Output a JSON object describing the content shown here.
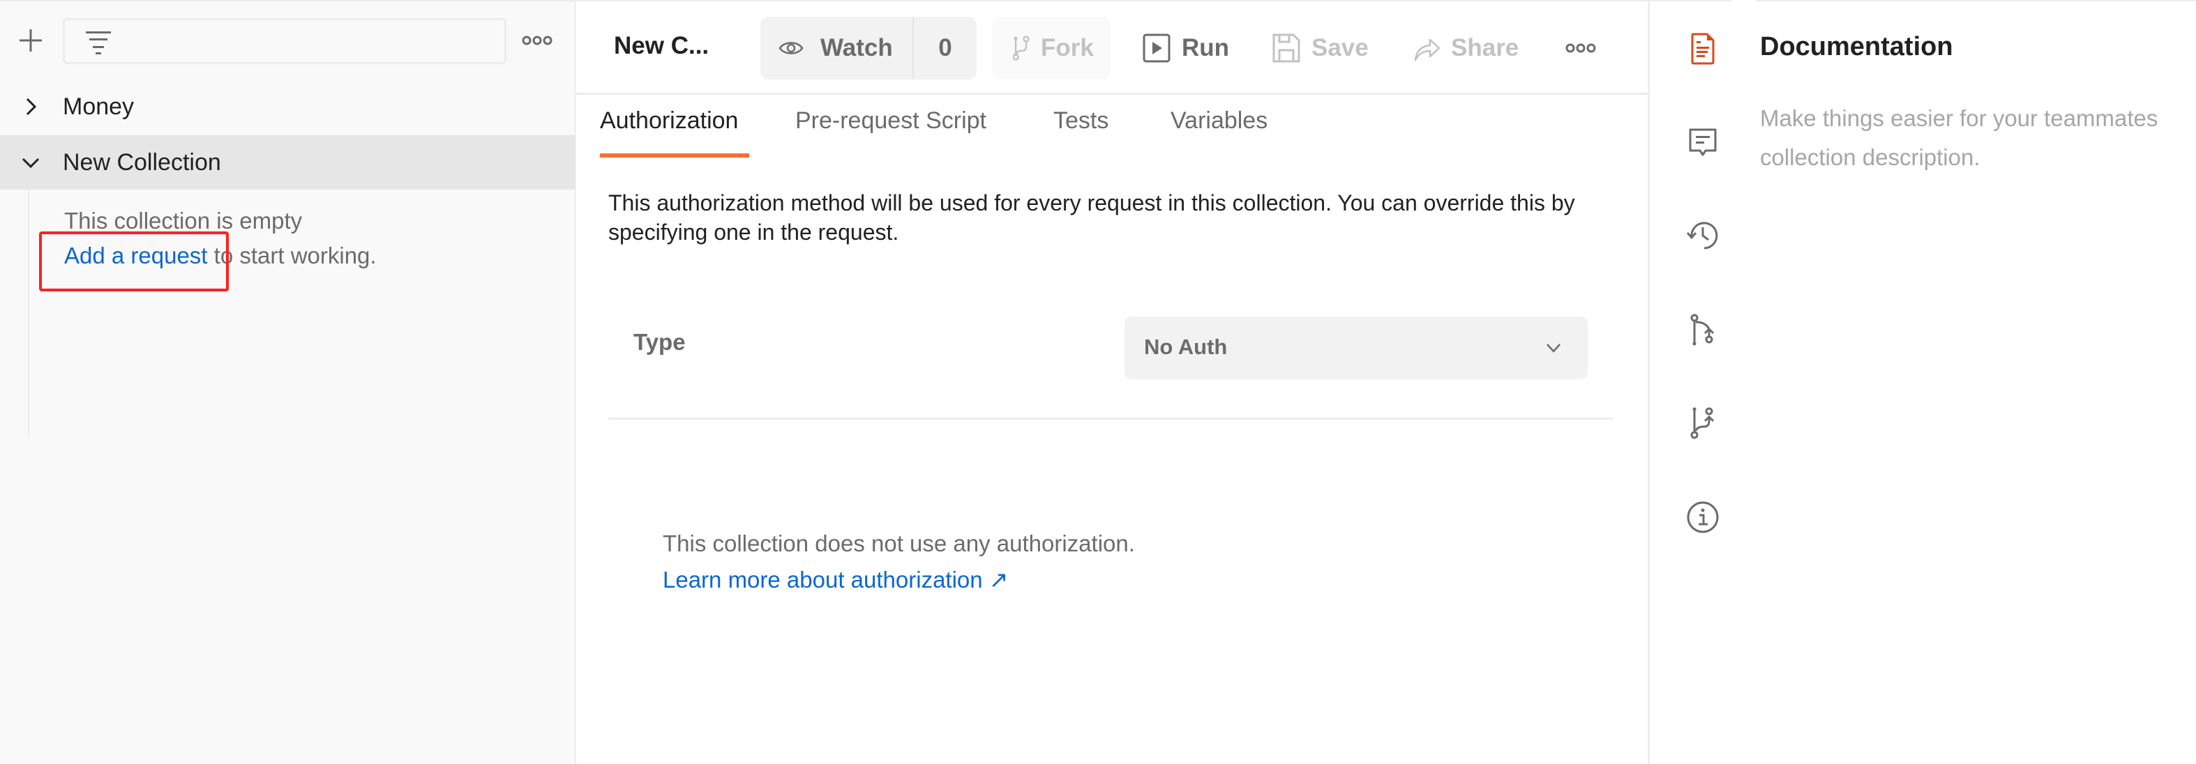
{
  "sidebar": {
    "new_button_icon": "plus-icon",
    "filter_icon": "filter-icon",
    "search_placeholder": "",
    "more_icon": "more-horizontal-icon",
    "collections": [
      {
        "name": "Money",
        "expanded": false
      },
      {
        "name": "New Collection",
        "expanded": true,
        "selected": true
      }
    ],
    "empty_state": {
      "line1": "This collection is empty",
      "link": "Add a request",
      "line2_suffix": " to start working."
    }
  },
  "header": {
    "title": "New C...",
    "watch_label": "Watch",
    "watch_count": "0",
    "fork_label": "Fork",
    "run_label": "Run",
    "save_label": "Save",
    "share_label": "Share"
  },
  "tabs": [
    {
      "label": "Authorization",
      "active": true
    },
    {
      "label": "Pre-request Script",
      "active": false
    },
    {
      "label": "Tests",
      "active": false
    },
    {
      "label": "Variables",
      "active": false
    }
  ],
  "authorization": {
    "description": "This authorization method will be used for every request in this collection. You can override this by specifying one in the request.",
    "type_label": "Type",
    "type_value": "No Auth",
    "no_auth_text": "This collection does not use any authorization.",
    "learn_more_link": "Learn more about authorization ↗"
  },
  "right_panel": {
    "title": "Documentation",
    "description_line1": "Make things easier for your teammates",
    "description_line2": "collection description.",
    "icons": [
      "documentation-icon",
      "comments-icon",
      "history-icon",
      "pull-request-icon",
      "fork-info-icon",
      "info-icon"
    ]
  },
  "colors": {
    "accent": "#ff6c37",
    "link": "#0b66d4",
    "highlight_box": "#ff2020",
    "doc_icon": "#d84a1b"
  }
}
